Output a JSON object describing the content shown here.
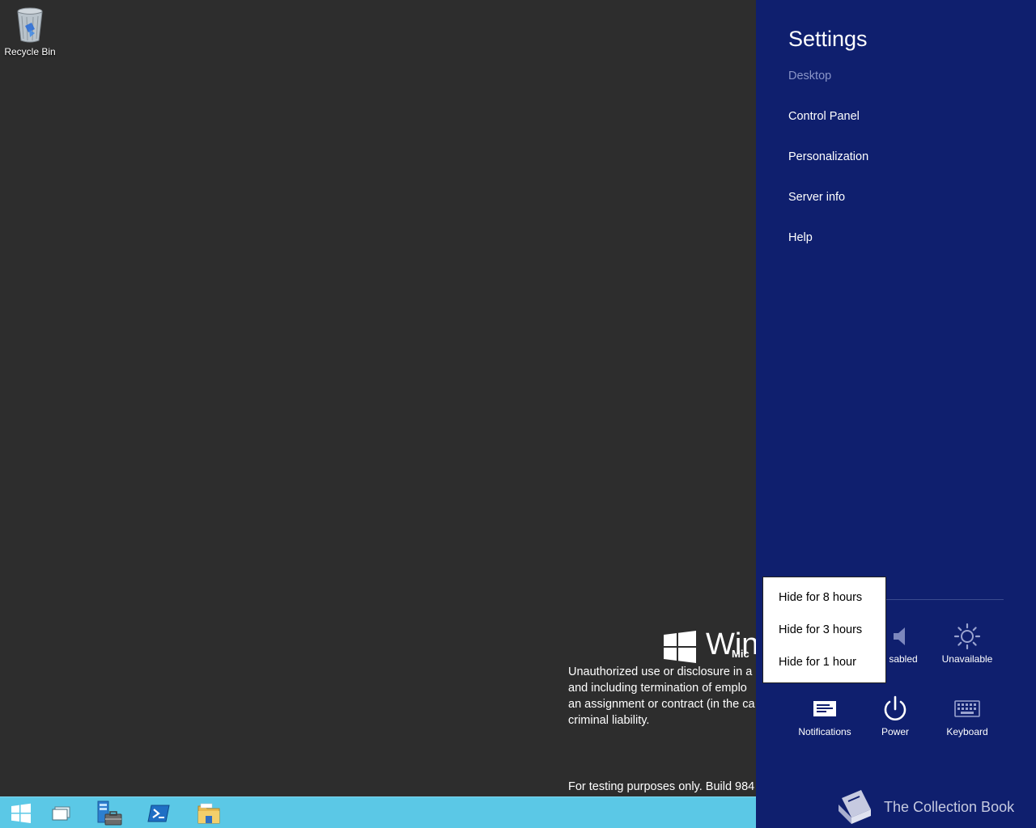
{
  "desktop": {
    "recycle_bin_label": "Recycle Bin",
    "watermark": {
      "brand_partial": "Wind",
      "subbrand_partial": "Mic",
      "legal_lines": [
        "Unauthorized use or disclosure in a",
        "and including termination of emplo",
        "an assignment or contract (in the ca",
        "criminal liability."
      ],
      "build_text": "For testing purposes only. Build 984"
    }
  },
  "taskbar": {
    "items": [
      "start-icon",
      "task-view-icon",
      "server-manager-icon",
      "powershell-icon",
      "file-explorer-icon"
    ],
    "color": "#5bc8e6"
  },
  "settings": {
    "title": "Settings",
    "context": "Desktop",
    "links": [
      "Control Panel",
      "Personalization",
      "Server info",
      "Help"
    ],
    "quick_row1": [
      {
        "icon": "speaker-icon",
        "label": "sabled"
      },
      {
        "icon": "brightness-icon",
        "label": "Unavailable"
      }
    ],
    "quick_row2": [
      {
        "icon": "notifications-icon",
        "label": "Notifications"
      },
      {
        "icon": "power-icon",
        "label": "Power"
      },
      {
        "icon": "keyboard-icon",
        "label": "Keyboard"
      }
    ],
    "background": "#0f1f6e"
  },
  "popup_menu": {
    "items": [
      "Hide for 8 hours",
      "Hide for 3 hours",
      "Hide for 1 hour"
    ]
  },
  "footer_watermark": {
    "text": "The Collection Book"
  }
}
